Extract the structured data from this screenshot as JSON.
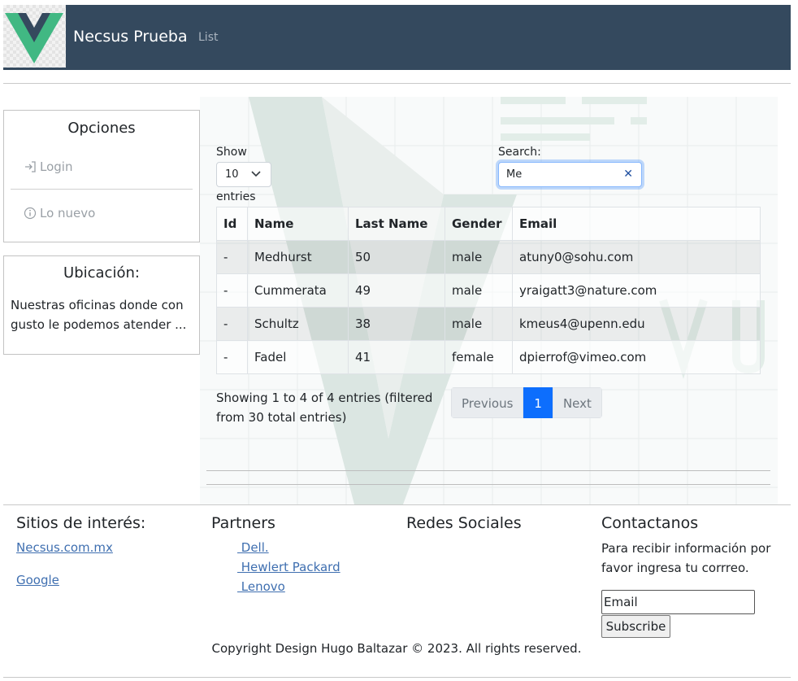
{
  "navbar": {
    "brand": "Necsus Prueba",
    "links": [
      "List"
    ],
    "logo_icon": "vue-logo",
    "colors": {
      "background": "#34495e",
      "logo_green": "#41b883",
      "logo_dark": "#35495e"
    }
  },
  "sidebar": {
    "options": {
      "title": "Opciones",
      "items": [
        {
          "label": "Login",
          "icon": "login-icon"
        },
        {
          "label": "Lo nuevo",
          "icon": "info-icon"
        }
      ]
    },
    "location": {
      "title": "Ubicación:",
      "text": "Nuestras oficinas donde con gusto le podemos atender ..."
    }
  },
  "datatable": {
    "length": {
      "show_label": "Show",
      "value": "10",
      "entries_label": "entries"
    },
    "search": {
      "label": "Search:",
      "value": "Me"
    },
    "columns": [
      "Id",
      "Name",
      "Last Name",
      "Gender",
      "Email"
    ],
    "rows": [
      [
        "-",
        "Medhurst",
        "50",
        "male",
        "atuny0@sohu.com"
      ],
      [
        "-",
        "Cummerata",
        "49",
        "male",
        "yraigatt3@nature.com"
      ],
      [
        "-",
        "Schultz",
        "38",
        "male",
        "kmeus4@upenn.edu"
      ],
      [
        "-",
        "Fadel",
        "41",
        "female",
        "dpierrof@vimeo.com"
      ]
    ],
    "info": "Showing 1 to 4 of 4 entries (filtered from 30 total entries)",
    "pagination": {
      "previous": "Previous",
      "current": "1",
      "next": "Next"
    },
    "accent": "#0d6efd"
  },
  "footer": {
    "sites": {
      "title": "Sitios de interés:",
      "links": [
        "Necsus.com.mx",
        "Google"
      ]
    },
    "partners": {
      "title": "Partners",
      "links": [
        " Dell.",
        " Hewlert Packard",
        " Lenovo"
      ]
    },
    "social": {
      "title": "Redes Sociales"
    },
    "contact": {
      "title": "Contactanos",
      "text": "Para recibir información por favor ingresa tu corrreo.",
      "email_value": "Email",
      "button": "Subscribe"
    },
    "copyright": "Copyright Design Hugo Baltazar © 2023. All rights reserved."
  }
}
